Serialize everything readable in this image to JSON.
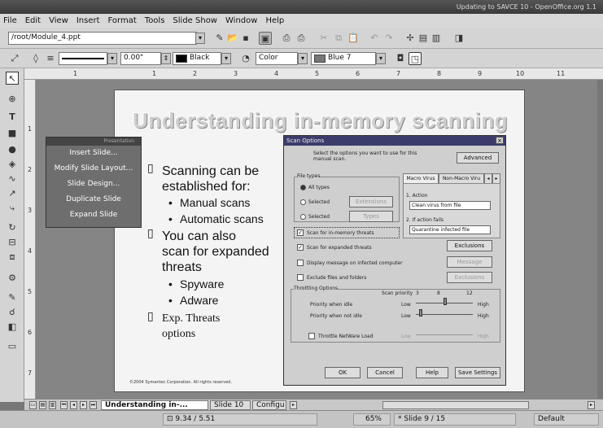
{
  "window": {
    "title": "Updating to SAVCE 10 - OpenOffice.org 1.1"
  },
  "menu": [
    "File",
    "Edit",
    "View",
    "Insert",
    "Format",
    "Tools",
    "Slide Show",
    "Window",
    "Help"
  ],
  "toolbar": {
    "file_path": "/root/Module_4.ppt",
    "line_width": "0.00\"",
    "line_color": "Black",
    "area_style": "Color",
    "area_color": "Blue 7"
  },
  "rulers": {
    "h_numbers": [
      "1",
      "1",
      "2",
      "3",
      "4",
      "5",
      "6",
      "7",
      "8",
      "9",
      "10",
      "11"
    ],
    "v_numbers": [
      "1",
      "2",
      "3",
      "4",
      "5",
      "6",
      "7"
    ]
  },
  "context_menu": {
    "header": "Presentation",
    "items": [
      "Insert Slide...",
      "Modify Slide Layout...",
      "Slide Design...",
      "Duplicate Slide",
      "Expand Slide"
    ]
  },
  "slide": {
    "title": "Understanding in-memory scanning",
    "b1": "Scanning can be established for:",
    "b1_line1": "Scanning can be",
    "b1_line2": "established for:",
    "b1_sub1": "Manual scans",
    "b1_sub2": "Automatic scans",
    "b2_line1": "You can also",
    "b2_line2": "scan for expanded",
    "b2_line3": "threats",
    "b2_sub1": "Spyware",
    "b2_sub2": "Adware",
    "b3_line1": "Exp. Threats",
    "b3_line2": "options",
    "copyright": "©2004 Symantec Corporation. All rights reserved."
  },
  "dialog": {
    "title": "Scan Options",
    "instruction": "Select the options you want to use for this manual scan.",
    "advanced": "Advanced",
    "file_types_label": "File types",
    "all_types": "All types",
    "selected1": "Selected",
    "selected2": "Selected",
    "extensions_btn": "Extensions",
    "types_btn": "Types",
    "tab_active": "Macro Virus",
    "tab_other": "Non-Macro Viru",
    "action1_label": "1. Action",
    "action1_value": "Clean virus from file",
    "action2_label": "2. If action fails",
    "action2_value": "Quarantine infected file",
    "scan_memory": "Scan for in-memory threats",
    "scan_expanded": "Scan for expanded threats",
    "exclusions_btn": "Exclusions",
    "display_msg": "Display message on infected computer",
    "exclude_files": "Exclude files and folders",
    "message_btn": "Message",
    "exclusions2_btn": "Exclusions",
    "throttle_label": "Throttling Options",
    "scan_priority": "Scan priority",
    "p3": "3",
    "p8": "8",
    "p12": "12",
    "priority_idle": "Priority when idle",
    "priority_not_idle": "Priority when not idle",
    "low": "Low",
    "high": "High",
    "low2": "Low",
    "high2": "High",
    "low3": "Low",
    "high3": "High",
    "throttle_netware": "Throttle NetWare Load",
    "ok": "OK",
    "cancel": "Cancel",
    "help": "Help",
    "save_settings": "Save Settings"
  },
  "slide_tabs": [
    "Understanding in-...",
    "Slide 10",
    "Configu"
  ],
  "status": {
    "position": "9.34 / 5.51",
    "zoom": "65%",
    "slide": "Slide 9 / 15",
    "layout": "Default"
  }
}
